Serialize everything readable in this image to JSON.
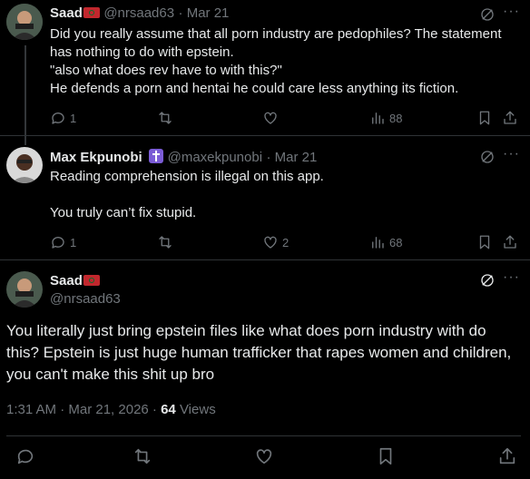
{
  "tweets": [
    {
      "name": "Saad",
      "handle": "@nrsaad63",
      "date": "· Mar 21",
      "text": "Did you really assume that all porn industry are pedophiles? The statement has nothing to do with epstein.\n\"also what does rev have to with this?\"\nHe defends a porn and hentai he could care less anything its fiction.",
      "replies": "1",
      "reposts": "",
      "likes": "",
      "views": "88"
    },
    {
      "name": "Max Ekpunobi",
      "handle": "@maxekpunobi",
      "date": "· Mar 21",
      "text": "Reading comprehension is illegal on this app.\n\nYou truly can’t fix stupid.",
      "replies": "1",
      "reposts": "",
      "likes": "2",
      "views": "68"
    }
  ],
  "main_tweet": {
    "name": "Saad",
    "handle": "@nrsaad63",
    "text": "You literally just bring epstein files like what does porn industry with do this? Epstein is just huge human trafficker that rapes women and children, you can't make this shit up bro",
    "timestamp": "1:31 AM · Mar 21, 2026 · ",
    "views_count": "64",
    "views_label": " Views"
  },
  "colors": {
    "background": "#000000",
    "text": "#e7e9ea",
    "muted": "#71767b",
    "divider": "#2f3336"
  }
}
